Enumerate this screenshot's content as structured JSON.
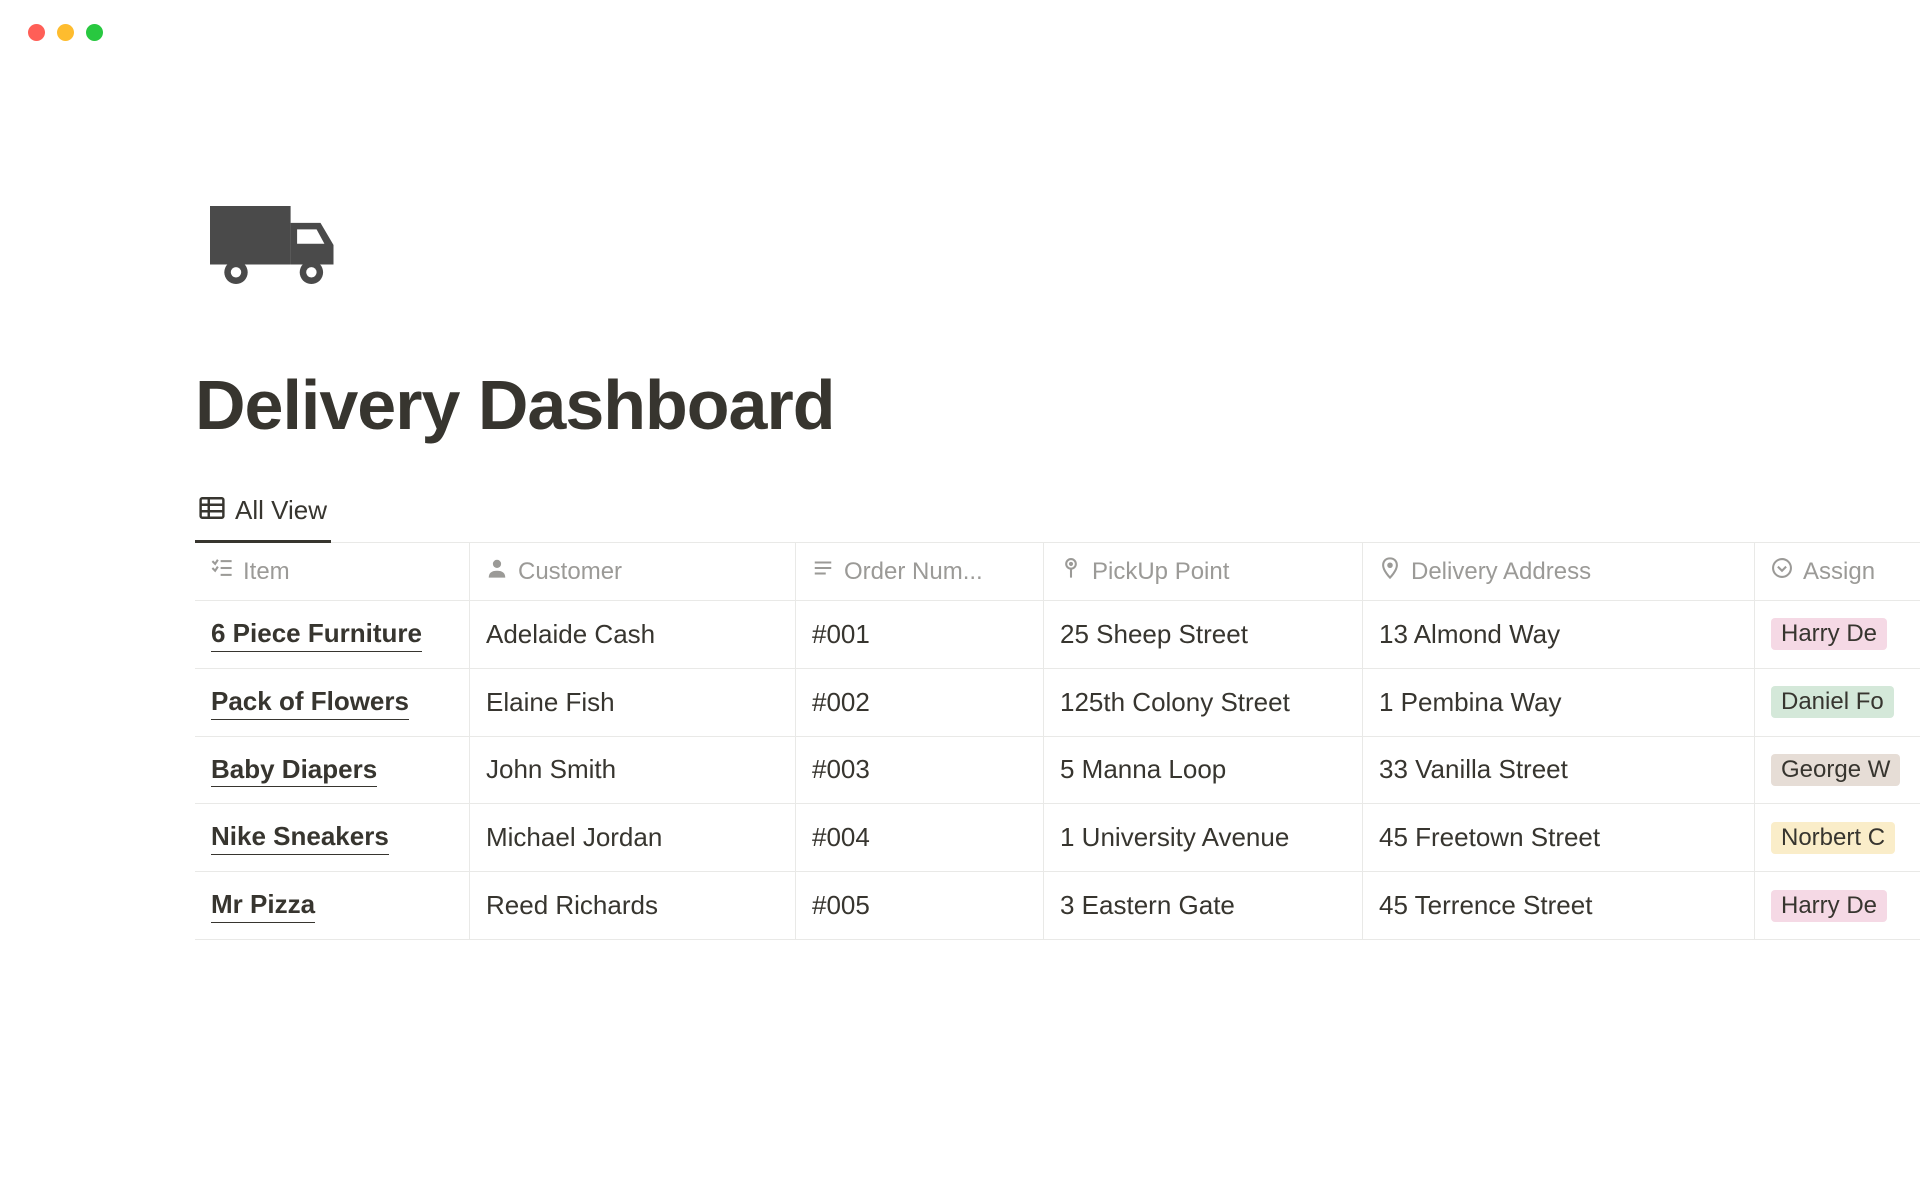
{
  "page": {
    "title": "Delivery Dashboard"
  },
  "view": {
    "tab_label": "All View"
  },
  "columns": {
    "item": "Item",
    "customer": "Customer",
    "order": "Order Num...",
    "pickup": "PickUp Point",
    "delivery": "Delivery Address",
    "assign": "Assign"
  },
  "rows": [
    {
      "item": "6 Piece Furniture",
      "customer": "Adelaide Cash",
      "order": "#001",
      "pickup": "25 Sheep Street",
      "delivery": "13 Almond Way",
      "assign": "Harry De",
      "assign_color": "pink"
    },
    {
      "item": "Pack of Flowers",
      "customer": "Elaine Fish",
      "order": "#002",
      "pickup": "125th Colony Street",
      "delivery": "1 Pembina Way",
      "assign": "Daniel Fo",
      "assign_color": "green"
    },
    {
      "item": "Baby Diapers",
      "customer": "John Smith",
      "order": "#003",
      "pickup": "5 Manna Loop",
      "delivery": "33 Vanilla Street",
      "assign": "George W",
      "assign_color": "brown"
    },
    {
      "item": "Nike Sneakers",
      "customer": "Michael Jordan",
      "order": "#004",
      "pickup": "1 University Avenue",
      "delivery": "45 Freetown Street",
      "assign": "Norbert C",
      "assign_color": "yellow"
    },
    {
      "item": "Mr Pizza",
      "customer": "Reed Richards",
      "order": "#005",
      "pickup": "3 Eastern Gate",
      "delivery": "45 Terrence Street",
      "assign": "Harry De",
      "assign_color": "pink"
    }
  ]
}
